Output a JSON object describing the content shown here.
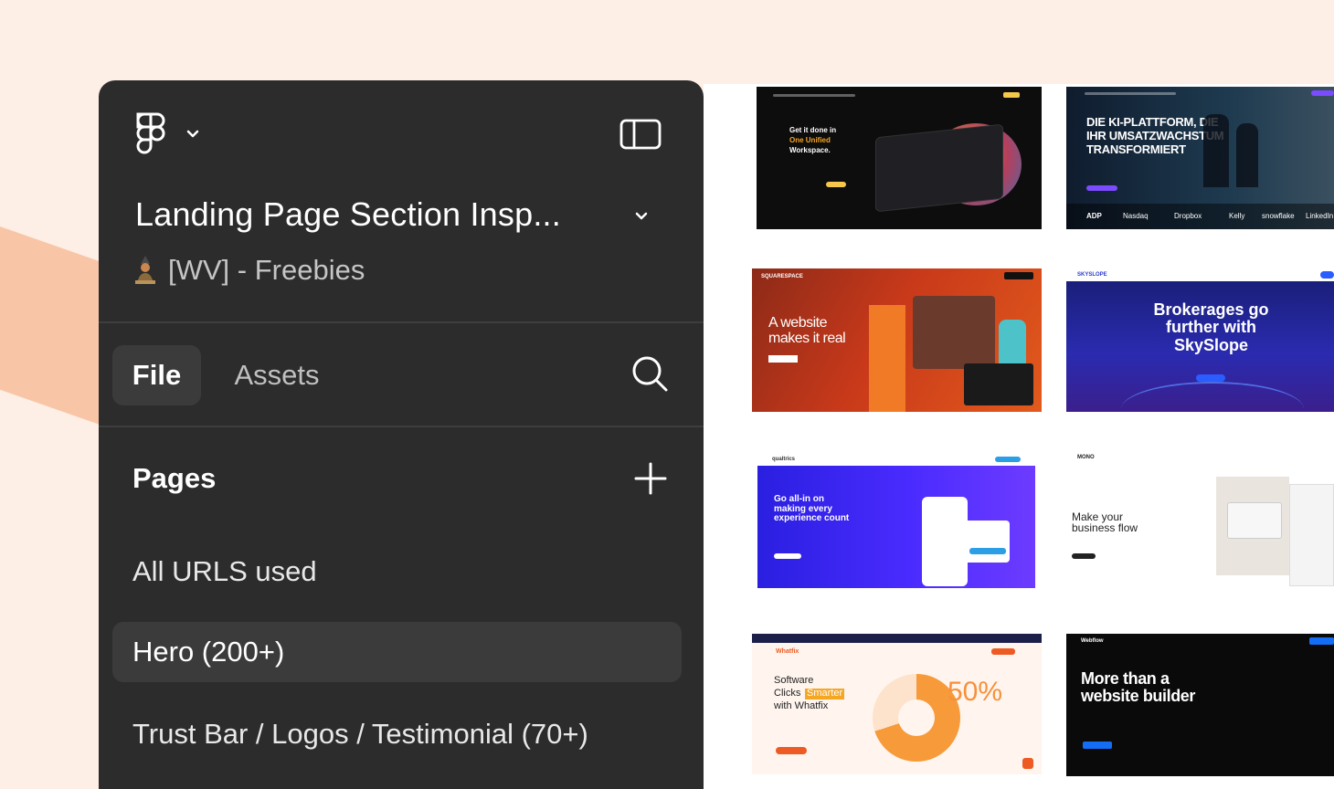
{
  "file": {
    "title": "Landing Page Section Insp...",
    "team": "[WV] - Freebies"
  },
  "tabs": {
    "file": "File",
    "assets": "Assets"
  },
  "pages": {
    "heading": "Pages",
    "items": [
      {
        "label": "All URLS used",
        "selected": false
      },
      {
        "label": "Hero (200+)",
        "selected": true
      },
      {
        "label": "Trust Bar / Logos / Testimonial (70+)",
        "selected": false
      }
    ]
  },
  "icons": {
    "logo": "figma-logo-icon",
    "menu": "chevron-down-icon",
    "sidebar": "sidebar-toggle-icon",
    "search": "search-icon",
    "add": "plus-icon"
  },
  "colors": {
    "panel": "#2c2c2c",
    "selected": "#3b3b3b",
    "background": "#fdeee6",
    "accent_shape": "#f8c6a6"
  },
  "thumbnails": {
    "t1": {
      "headline": "Get it done in",
      "accent": "One Unified",
      "tail": "Workspace."
    },
    "t2": {
      "headline": "DIE KI-PLATTFORM, DIE\nIHR UMSATZWACHSTUM\nTRANSFORMIERT",
      "logos": [
        "ADP",
        "Nasdaq",
        "Dropbox",
        "Kelly",
        "snowflake",
        "LinkedIn"
      ]
    },
    "t3": {
      "headline": "A website\nmakes it real",
      "brand": "SQUARESPACE"
    },
    "t4": {
      "headline": "Brokerages go\nfurther with\nSkySlope",
      "brand": "SKYSLOPE"
    },
    "t5": {
      "headline": "Go all-in on\nmaking every\nexperience count",
      "brand": "qualtrics"
    },
    "t6": {
      "headline": "Make your\nbusiness flow",
      "brand": "MONO"
    },
    "t7": {
      "line1": "Software",
      "line2a": "Clicks ",
      "line2b": "Smarter",
      "line3": "with Whatfix",
      "stat": "50%",
      "brand": "Whatfix"
    },
    "t8": {
      "headline": "More than a\nwebsite builder",
      "brand": "Webflow"
    }
  }
}
